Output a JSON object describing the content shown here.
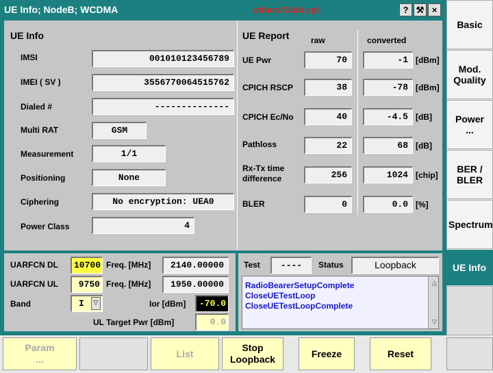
{
  "title": "UE Info; NodeB; WCDMA",
  "file": "others/14db.cpl",
  "title_buttons": {
    "help": "?",
    "tool": "⚒",
    "close": "×"
  },
  "ue_info": {
    "header": "UE Info",
    "rows": [
      {
        "label": "IMSI",
        "value": "001010123456789"
      },
      {
        "label": "IMEI ( SV )",
        "value": "3556770064515762"
      },
      {
        "label": "Dialed #",
        "value": "--------------"
      },
      {
        "label": "Multi RAT",
        "value": "GSM"
      },
      {
        "label": "Measurement",
        "value": "1/1"
      },
      {
        "label": "Positioning",
        "value": "None"
      },
      {
        "label": "Ciphering",
        "value": "No encryption: UEA0"
      },
      {
        "label": "Power Class",
        "value": "4"
      }
    ]
  },
  "ue_report": {
    "header": "UE Report",
    "col_raw": "raw",
    "col_conv": "converted",
    "rows": [
      {
        "label": "UE Pwr",
        "raw": "70",
        "conv": "-1",
        "unit": "[dBm]"
      },
      {
        "label": "CPICH RSCP",
        "raw": "38",
        "conv": "-78",
        "unit": "[dBm]"
      },
      {
        "label": "CPICH Ec/No",
        "raw": "40",
        "conv": "-4.5",
        "unit": "[dB]"
      },
      {
        "label": "Pathloss",
        "raw": "22",
        "conv": "68",
        "unit": "[dB]"
      },
      {
        "label": "Rx-Tx time\ndifference",
        "raw": "256",
        "conv": "1024",
        "unit": "[chip]"
      },
      {
        "label": "BLER",
        "raw": "0",
        "conv": "0.0",
        "unit": "[%]"
      }
    ]
  },
  "rf": {
    "uarfcn_dl_label": "UARFCN DL",
    "uarfcn_dl": "10700",
    "freq_label": "Freq. [MHz]",
    "freq_dl": "2140.00000",
    "uarfcn_ul_label": "UARFCN UL",
    "uarfcn_ul": "9750",
    "freq_ul": "1950.00000",
    "band_label": "Band",
    "band": "I",
    "ior_label": "Ior [dBm]",
    "ior": "-70.0",
    "ul_target_label": "UL Target Pwr [dBm]",
    "ul_target": "0.0"
  },
  "test": {
    "label": "Test",
    "value": "----",
    "status_label": "Status",
    "status": "Loopback"
  },
  "messages": [
    "RadioBearerSetupComplete",
    "CloseUETestLoop",
    "CloseUETestLoopComplete"
  ],
  "side_menu": [
    "Basic",
    "Mod.\nQuality",
    "Power\n...",
    "BER /\nBLER",
    "Spectrum",
    "UE Info",
    ""
  ],
  "bottom": [
    "Param\n...",
    "",
    "List",
    "Stop\nLoopback",
    "Freeze",
    "Reset",
    ""
  ]
}
